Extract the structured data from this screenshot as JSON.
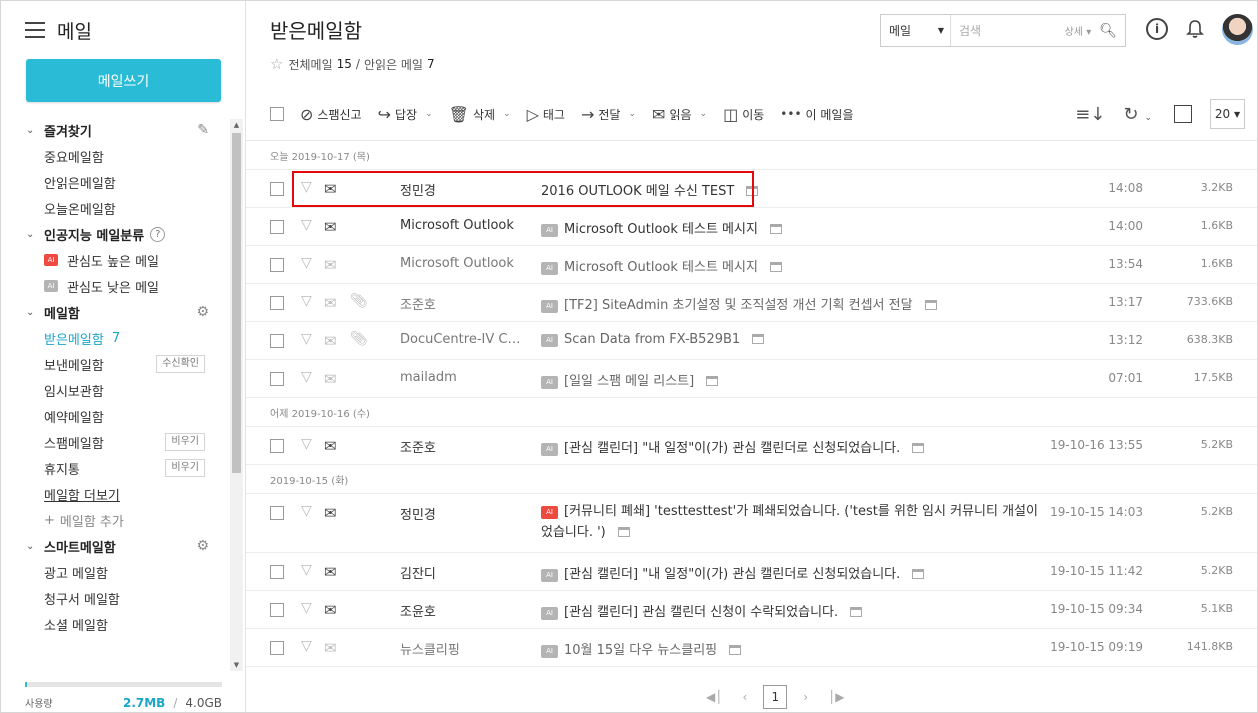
{
  "sidebar": {
    "title": "메일",
    "compose": "메일쓰기",
    "favorites": {
      "label": "즐겨찾기",
      "items": [
        "중요메일함",
        "안읽은메일함",
        "오늘온메일함"
      ]
    },
    "ai": {
      "label": "인공지능 메일분류",
      "help": "?",
      "badge": "AI",
      "items": [
        "관심도 높은 메일",
        "관심도 낮은 메일"
      ]
    },
    "mailbox": {
      "label": "메일함",
      "inbox": "받은메일함",
      "inbox_count": "7",
      "sent": "보낸메일함",
      "sent_btn": "수신확인",
      "drafts": "임시보관함",
      "scheduled": "예약메일함",
      "spam": "스팸메일함",
      "spam_btn": "비우기",
      "trash": "휴지통",
      "trash_btn": "비우기",
      "more": "메일함 더보기",
      "add": "메일함 추가"
    },
    "smart": {
      "label": "스마트메일함",
      "items": [
        "광고 메일함",
        "청구서 메일함",
        "소셜 메일함"
      ]
    },
    "storage": {
      "label": "사용량",
      "used": "2.7MB",
      "sep": "/",
      "total": "4.0GB",
      "used_fraction": 0.0007
    }
  },
  "header": {
    "title": "받은메일함",
    "summary_all_label": "전체메일",
    "summary_all": "15",
    "summary_sep": "/",
    "summary_unread_label": "안읽은 메일",
    "summary_unread": "7",
    "search_scope": "메일",
    "search_placeholder": "검색",
    "search_detail": "상세"
  },
  "toolbar": {
    "spam": "스팸신고",
    "reply": "답장",
    "delete": "삭제",
    "tag": "태그",
    "forward": "전달",
    "read": "읽음",
    "move": "이동",
    "more": "이 메일을",
    "page_size": "20"
  },
  "groups": [
    {
      "date": "오늘 2019-10-17 (목)",
      "rows": [
        {
          "from": "정민경",
          "subject": "2016 OUTLOOK 메일 수신 TEST",
          "time": "14:08",
          "size": "3.2KB",
          "read": false,
          "ai": "",
          "clip": false,
          "highlight": true
        },
        {
          "from": "Microsoft Outlook",
          "subject": "Microsoft Outlook 테스트 메시지",
          "time": "14:00",
          "size": "1.6KB",
          "read": false,
          "ai": "AI",
          "clip": false
        },
        {
          "from": "Microsoft Outlook",
          "subject": "Microsoft Outlook 테스트 메시지",
          "time": "13:54",
          "size": "1.6KB",
          "read": true,
          "ai": "AI",
          "clip": false
        },
        {
          "from": "조준호",
          "subject": "[TF2] SiteAdmin 초기설정 및 조직설정 개선 기획 컨셉서 전달",
          "time": "13:17",
          "size": "733.6KB",
          "read": true,
          "ai": "AI",
          "clip": true
        },
        {
          "from": "DocuCentre-IV C…",
          "subject": "Scan Data from FX-B529B1",
          "time": "13:12",
          "size": "638.3KB",
          "read": true,
          "ai": "AI",
          "clip": true
        },
        {
          "from": "mailadm",
          "subject": "[일일 스팸 메일 리스트]",
          "time": "07:01",
          "size": "17.5KB",
          "read": true,
          "ai": "AI",
          "clip": false
        }
      ]
    },
    {
      "date": "어제 2019-10-16 (수)",
      "rows": [
        {
          "from": "조준호",
          "subject": "[관심 캘린더] \"내 일정\"이(가) 관심 캘린더로 신청되었습니다.",
          "time": "19-10-16 13:55",
          "size": "5.2KB",
          "read": false,
          "ai": "AI",
          "clip": false
        }
      ]
    },
    {
      "date": "2019-10-15 (화)",
      "rows": [
        {
          "from": "정민경",
          "subject": "[커뮤니티 폐쇄] 'testtesttest'가 폐쇄되었습니다. ('test를 위한 임시 커뮤니티 개설이었습니다. ')",
          "time": "19-10-15 14:03",
          "size": "5.2KB",
          "read": false,
          "ai": "AI",
          "ai_red": true,
          "clip": false,
          "tall": true
        },
        {
          "from": "김잔디",
          "subject": "[관심 캘린더] \"내 일정\"이(가) 관심 캘린더로 신청되었습니다.",
          "time": "19-10-15 11:42",
          "size": "5.2KB",
          "read": false,
          "ai": "AI",
          "clip": false
        },
        {
          "from": "조윤호",
          "subject": "[관심 캘린더] 관심 캘린더 신청이 수락되었습니다.",
          "time": "19-10-15 09:34",
          "size": "5.1KB",
          "read": false,
          "ai": "AI",
          "clip": false
        },
        {
          "from": "뉴스클리핑",
          "subject": "10월 15일 다우 뉴스클리핑",
          "time": "19-10-15 09:19",
          "size": "141.8KB",
          "read": true,
          "ai": "AI",
          "clip": false
        }
      ]
    }
  ],
  "pager": {
    "current": "1"
  }
}
